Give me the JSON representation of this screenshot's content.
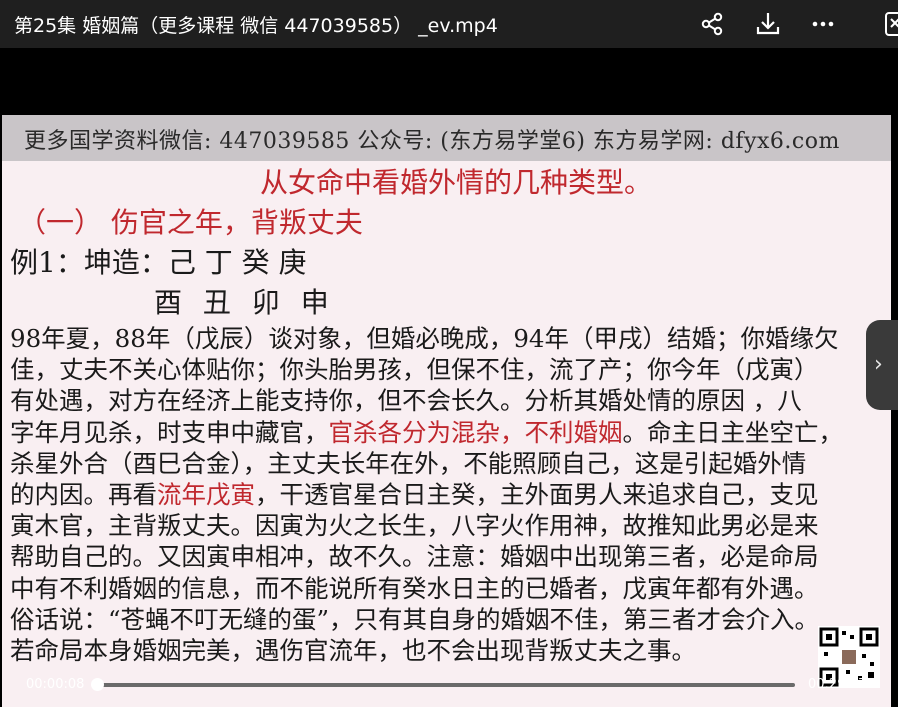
{
  "window": {
    "title": "第25集 婚姻篇（更多课程 微信 447039585） _ev.mp4",
    "icons": [
      "share-icon",
      "download-icon",
      "more-icon",
      "exit-icon"
    ]
  },
  "slide": {
    "banner": "更多国学资料微信: 447039585 公众号: (东方易学堂6) 东方易学网: dfyx6.com",
    "heading": "从女命中看婚外情的几种类型。",
    "subheading": "（一）  伤官之年，背叛丈夫",
    "example_line1": "例1：坤造：己 丁 癸 庚",
    "example_line2": "酉 丑 卯 申",
    "lines": [
      [
        {
          "t": "98年夏，88年（戊辰）谈对象，但婚必晚成，94年（甲戌）结婚；你婚缘欠",
          "red": false
        }
      ],
      [
        {
          "t": "佳，丈夫不关心体贴你；你头胎男孩，但保不住，流了产；你今年（戊寅）",
          "red": false
        }
      ],
      [
        {
          "t": "有处遇，对方在经济上能支持你，但不会长久。分析其婚处情的原因 ，八",
          "red": false
        }
      ],
      [
        {
          "t": "字年月见杀，时支申中藏官，",
          "red": false
        },
        {
          "t": "官杀各分为混杂，不利婚姻",
          "red": true
        },
        {
          "t": "。命主日主坐空亡，",
          "red": false
        }
      ],
      [
        {
          "t": "杀星外合（酉巳合金），主丈夫长年在外，不能照顾自己，这是引起婚外情",
          "red": false
        }
      ],
      [
        {
          "t": "的内因。再看",
          "red": false
        },
        {
          "t": "流年戊寅",
          "red": true
        },
        {
          "t": "，干透官星合日主癸，主外面男人来追求自己，支见",
          "red": false
        }
      ],
      [
        {
          "t": "寅木官，主背叛丈夫。因寅为火之长生，八字火作用神，故推知此男必是来",
          "red": false
        }
      ],
      [
        {
          "t": "帮助自己的。又因寅申相冲，故不久。注意：婚姻中出现第三者，必是命局",
          "red": false
        }
      ],
      [
        {
          "t": "中有不利婚姻的信息，而不能说所有癸水日主的已婚者，戊寅年都有外遇。",
          "red": false
        }
      ],
      [
        {
          "t": "俗话说：“苍蝇不叮无缝的蛋”，只有其自身的婚姻不佳，第三者才会介入。",
          "red": false
        }
      ],
      [
        {
          "t": "若命局本身婚姻完美，遇伤官流年，也不会出现背叛丈夫之事。",
          "red": false
        }
      ]
    ]
  },
  "player": {
    "current_time": "00:00:08",
    "total_time": "00:29:37",
    "progress": 0.005,
    "side_handle": "›"
  },
  "colors": {
    "accent_red": "#c0282e",
    "titlebar_bg": "#1f1f1f",
    "slide_bg": "#f9eff2"
  }
}
